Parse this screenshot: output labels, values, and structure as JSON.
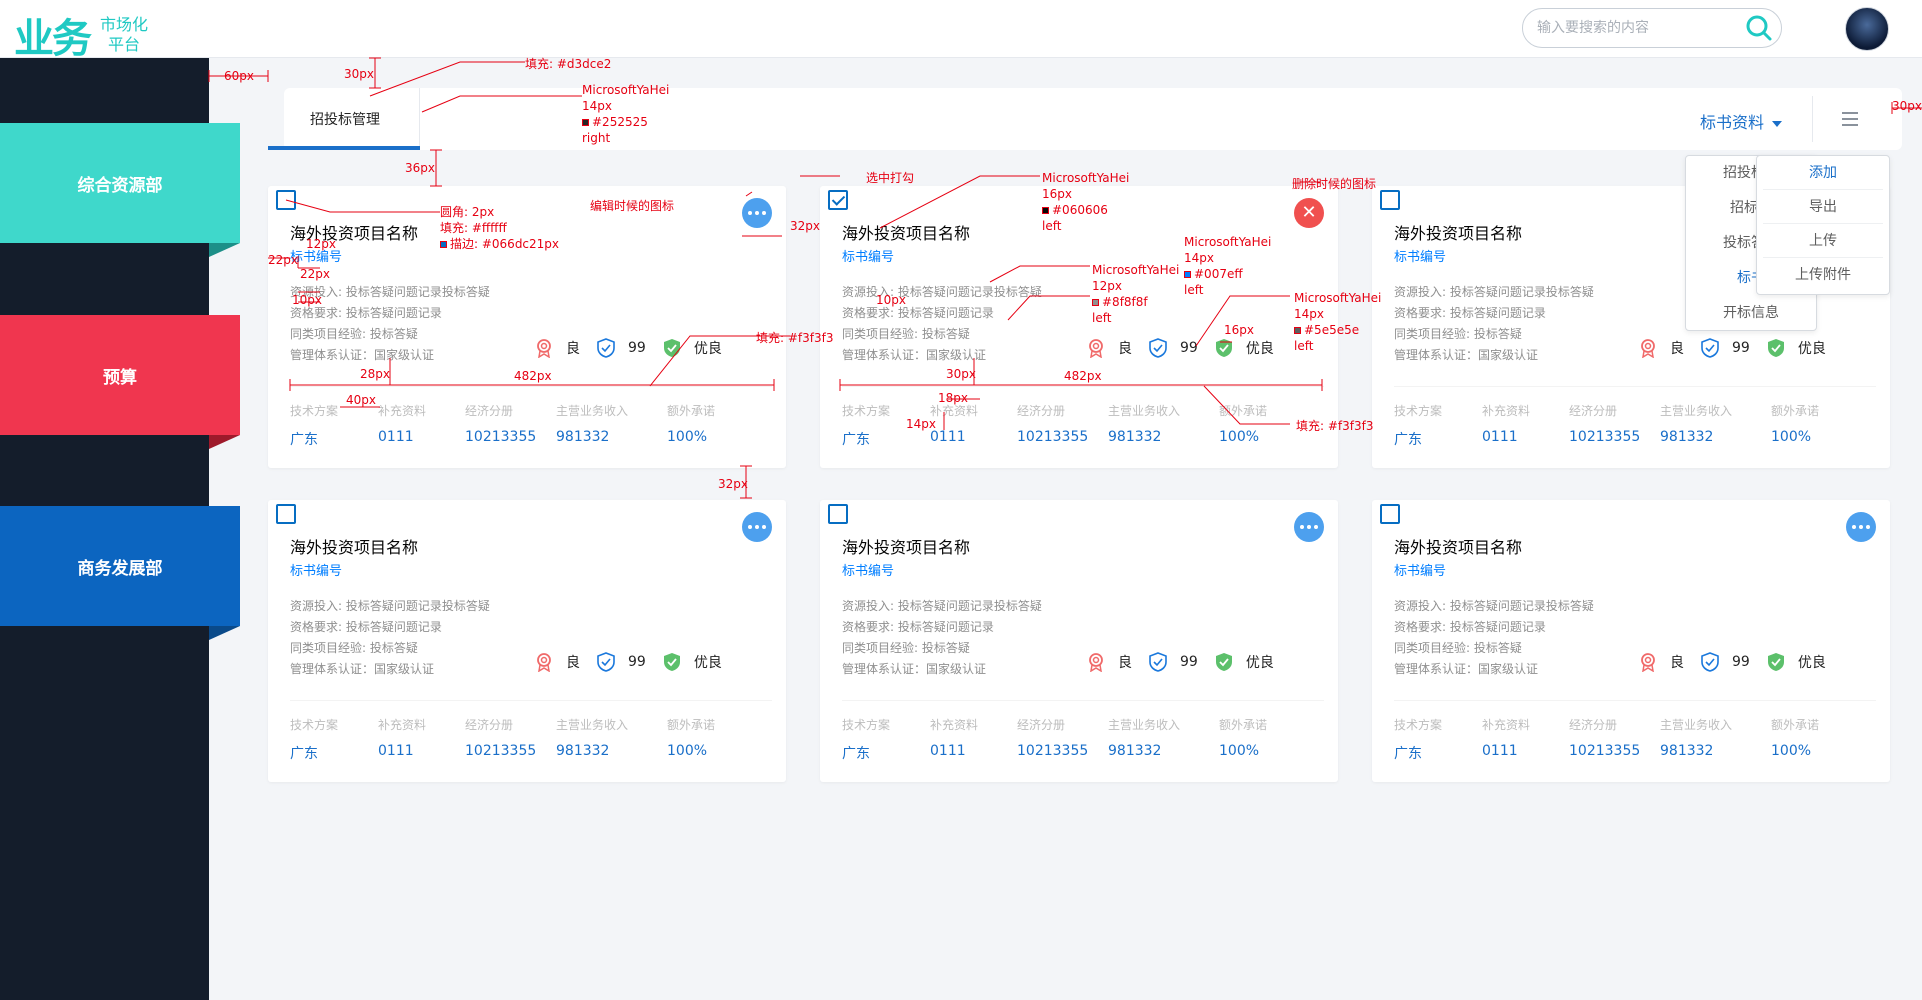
{
  "header": {
    "logo_mark": "业务",
    "logo_line1": "市场化",
    "logo_line2": "平台",
    "search_placeholder": "输入要搜索的内容"
  },
  "sidebar": {
    "items": [
      {
        "label": "综合资源部",
        "color": "#3fd8cb"
      },
      {
        "label": "预算",
        "color": "#f0364f"
      },
      {
        "label": "商务发展部",
        "color": "#0c65c0"
      }
    ]
  },
  "tabbar": {
    "tab_label": "招投标管理",
    "doc_select": "标书资料"
  },
  "popup_left": [
    "招投标网",
    "招标信",
    "投标答疑",
    "标书",
    "开标信息"
  ],
  "popup_right": [
    "添加",
    "导出",
    "上传",
    "上传附件"
  ],
  "cards": [
    {
      "checked": false,
      "mode": "edit",
      "title": "海外投资项目名称",
      "subtitle": "标书编号",
      "info": [
        "资源投入: 投标答疑问题记录投标答疑",
        "资格要求: 投标答疑问题记录",
        "同类项目经验: 投标答疑",
        "管理体系认证：国家级认证"
      ],
      "badges": [
        "良",
        "99",
        "优良"
      ],
      "cols": [
        {
          "h": "技术方案",
          "v": "广东"
        },
        {
          "h": "补充资料",
          "v": "0111"
        },
        {
          "h": "经济分册",
          "v": "10213355"
        },
        {
          "h": "主营业务收入",
          "v": "981332"
        },
        {
          "h": "额外承诺",
          "v": "100%"
        }
      ]
    },
    {
      "checked": true,
      "mode": "delete",
      "title": "海外投资项目名称",
      "subtitle": "标书编号",
      "info": [
        "资源投入: 投标答疑问题记录投标答疑",
        "资格要求: 投标答疑问题记录",
        "同类项目经验: 投标答疑",
        "管理体系认证：国家级认证"
      ],
      "badges": [
        "良",
        "99",
        "优良"
      ],
      "cols": [
        {
          "h": "技术方案",
          "v": "广东"
        },
        {
          "h": "补充资料",
          "v": "0111"
        },
        {
          "h": "经济分册",
          "v": "10213355"
        },
        {
          "h": "主营业务收入",
          "v": "981332"
        },
        {
          "h": "额外承诺",
          "v": "100%"
        }
      ]
    },
    {
      "checked": false,
      "mode": "none",
      "title": "海外投资项目名称",
      "subtitle": "标书编号",
      "info": [
        "资源投入: 投标答疑问题记录投标答疑",
        "资格要求: 投标答疑问题记录",
        "同类项目经验: 投标答疑",
        "管理体系认证：国家级认证"
      ],
      "badges": [
        "良",
        "99",
        "优良"
      ],
      "cols": [
        {
          "h": "技术方案",
          "v": "广东"
        },
        {
          "h": "补充资料",
          "v": "0111"
        },
        {
          "h": "经济分册",
          "v": "10213355"
        },
        {
          "h": "主营业务收入",
          "v": "981332"
        },
        {
          "h": "额外承诺",
          "v": "100%"
        }
      ]
    },
    {
      "checked": false,
      "mode": "edit",
      "title": "海外投资项目名称",
      "subtitle": "标书编号",
      "info": [
        "资源投入: 投标答疑问题记录投标答疑",
        "资格要求: 投标答疑问题记录",
        "同类项目经验: 投标答疑",
        "管理体系认证：国家级认证"
      ],
      "badges": [
        "良",
        "99",
        "优良"
      ],
      "cols": [
        {
          "h": "技术方案",
          "v": "广东"
        },
        {
          "h": "补充资料",
          "v": "0111"
        },
        {
          "h": "经济分册",
          "v": "10213355"
        },
        {
          "h": "主营业务收入",
          "v": "981332"
        },
        {
          "h": "额外承诺",
          "v": "100%"
        }
      ]
    },
    {
      "checked": false,
      "mode": "edit",
      "title": "海外投资项目名称",
      "subtitle": "标书编号",
      "info": [
        "资源投入: 投标答疑问题记录投标答疑",
        "资格要求: 投标答疑问题记录",
        "同类项目经验: 投标答疑",
        "管理体系认证：国家级认证"
      ],
      "badges": [
        "良",
        "99",
        "优良"
      ],
      "cols": [
        {
          "h": "技术方案",
          "v": "广东"
        },
        {
          "h": "补充资料",
          "v": "0111"
        },
        {
          "h": "经济分册",
          "v": "10213355"
        },
        {
          "h": "主营业务收入",
          "v": "981332"
        },
        {
          "h": "额外承诺",
          "v": "100%"
        }
      ]
    },
    {
      "checked": false,
      "mode": "edit",
      "title": "海外投资项目名称",
      "subtitle": "标书编号",
      "info": [
        "资源投入: 投标答疑问题记录投标答疑",
        "资格要求: 投标答疑问题记录",
        "同类项目经验: 投标答疑",
        "管理体系认证：国家级认证"
      ],
      "badges": [
        "良",
        "99",
        "优良"
      ],
      "cols": [
        {
          "h": "技术方案",
          "v": "广东"
        },
        {
          "h": "补充资料",
          "v": "0111"
        },
        {
          "h": "经济分册",
          "v": "10213355"
        },
        {
          "h": "主营业务收入",
          "v": "981332"
        },
        {
          "h": "额外承诺",
          "v": "100%"
        }
      ]
    }
  ],
  "annotations": {
    "a60": "60px",
    "a30top": "30px",
    "a30right": "30px",
    "a36": "36px",
    "fill_tab": "填充: #d3dce2",
    "tab_font": [
      "MicrosoftYaHei",
      "14px",
      "#252525",
      "right"
    ],
    "select_tick": "选中打勾",
    "title_font": [
      "MicrosoftYaHei",
      "16px",
      "#060606",
      "left"
    ],
    "delete_icon": "删除时候的图标",
    "edit_icon": "编辑时候的图标",
    "checkbox_spec": [
      "圆角: 2px",
      "填充: #ffffff",
      "描边: #066dc21px"
    ],
    "a12": "12px",
    "a22a": "22px",
    "a22b": "22px",
    "a10a": "10px",
    "a10b": "10px",
    "sub_font": [
      "MicrosoftYaHei",
      "14px",
      "#007eff",
      "left"
    ],
    "info_font": [
      "MicrosoftYaHei",
      "12px",
      "#8f8f8f",
      "left"
    ],
    "badge_font": [
      "MicrosoftYaHei",
      "14px",
      "#5e5e5e",
      "left"
    ],
    "a32mid": "32px",
    "a16": "16px",
    "fill_sep1": "填充: #f3f3f3",
    "fill_sep2": "填充: #f3f3f3",
    "a28": "28px",
    "a482a": "482px",
    "a482b": "482px",
    "a40": "40px",
    "a30mid": "30px",
    "a18": "18px",
    "a14": "14px",
    "a32v": "32px"
  }
}
